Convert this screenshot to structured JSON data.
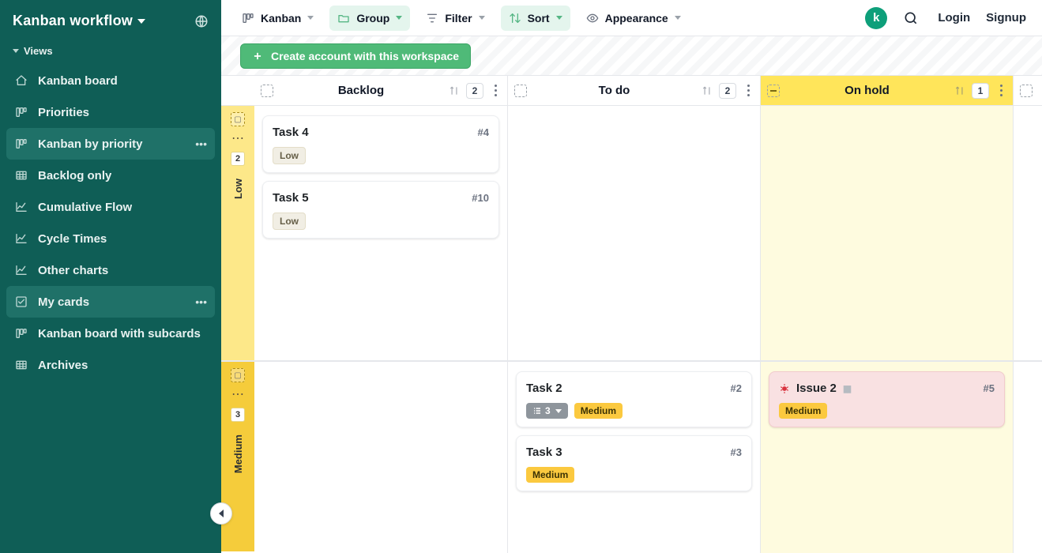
{
  "app": {
    "title": "Kanban workflow",
    "avatar_letter": "k"
  },
  "sidebar": {
    "section_label": "Views",
    "items": [
      {
        "label": "Kanban board",
        "icon": "home"
      },
      {
        "label": "Priorities",
        "icon": "kanban"
      },
      {
        "label": "Kanban by priority",
        "icon": "kanban",
        "selected": true,
        "dots": true
      },
      {
        "label": "Backlog only",
        "icon": "table"
      },
      {
        "label": "Cumulative Flow",
        "icon": "line-chart"
      },
      {
        "label": "Cycle Times",
        "icon": "line-chart"
      },
      {
        "label": "Other charts",
        "icon": "line-chart"
      },
      {
        "label": "My cards",
        "icon": "check-sq",
        "hovered": true,
        "dots": true
      },
      {
        "label": "Kanban board with subcards",
        "icon": "kanban"
      },
      {
        "label": "Archives",
        "icon": "table"
      }
    ]
  },
  "toolbar": {
    "items": [
      {
        "label": "Kanban",
        "icon": "kanban",
        "variant": "plain"
      },
      {
        "label": "Group",
        "icon": "folder",
        "variant": "mint"
      },
      {
        "label": "Filter",
        "icon": "filter",
        "variant": "plain"
      },
      {
        "label": "Sort",
        "icon": "sort",
        "variant": "mint"
      },
      {
        "label": "Appearance",
        "icon": "eye",
        "variant": "plain"
      }
    ],
    "login": "Login",
    "signup": "Signup"
  },
  "banner": {
    "cta": "Create account with this workspace"
  },
  "board": {
    "columns": [
      {
        "key": "backlog",
        "title": "Backlog",
        "count": "2"
      },
      {
        "key": "todo",
        "title": "To do",
        "count": "2"
      },
      {
        "key": "onhold",
        "title": "On hold",
        "count": "1",
        "highlight": true
      }
    ],
    "lanes": [
      {
        "key": "low",
        "label": "Low",
        "count": "2",
        "color": "yellow"
      },
      {
        "key": "medium",
        "label": "Medium",
        "count": "3",
        "color": "gold"
      }
    ],
    "cards": {
      "low": {
        "backlog": [
          {
            "title": "Task 4",
            "id": "#4",
            "tags": [
              {
                "text": "Low",
                "type": "low"
              }
            ]
          },
          {
            "title": "Task 5",
            "id": "#10",
            "tags": [
              {
                "text": "Low",
                "type": "low"
              }
            ]
          }
        ],
        "todo": [],
        "onhold": []
      },
      "medium": {
        "backlog": [],
        "todo": [
          {
            "title": "Task 2",
            "id": "#2",
            "tags": [
              {
                "text": "3",
                "type": "sub"
              },
              {
                "text": "Medium",
                "type": "med"
              }
            ]
          },
          {
            "title": "Task 3",
            "id": "#3",
            "tags": [
              {
                "text": "Medium",
                "type": "med"
              }
            ]
          }
        ],
        "onhold": [
          {
            "title": "Issue 2",
            "id": "#5",
            "tags": [
              {
                "text": "Medium",
                "type": "med"
              }
            ],
            "variant": "pink",
            "bug": true,
            "drag": true
          }
        ]
      }
    }
  }
}
